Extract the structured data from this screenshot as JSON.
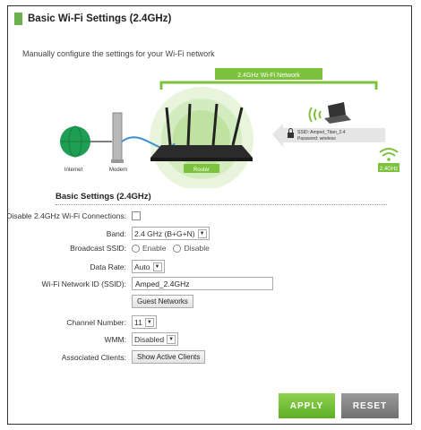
{
  "header": {
    "title": "Basic Wi-Fi Settings (2.4GHz)",
    "subtitle": "Manually configure the settings for your Wi-Fi network"
  },
  "diagram": {
    "network_label": "2.4GHz Wi-Fi Network",
    "internet_label": "Internet",
    "modem_label": "Modem",
    "router_label": "Router",
    "ssid_text": "SSID: Amped_Titan_2.4",
    "password_text": "Password: wireless",
    "band_badge": "2.4GHz"
  },
  "section": {
    "title": "Basic Settings (2.4GHz)"
  },
  "form": {
    "disable_label": "Disable 2.4GHz Wi-Fi Connections:",
    "band_label": "Band:",
    "band_value": "2.4 GHz (B+G+N)",
    "broadcast_label": "Broadcast SSID:",
    "enable_label": "Enable",
    "disable_opt_label": "Disable",
    "data_rate_label": "Data Rate:",
    "data_rate_value": "Auto",
    "ssid_label": "Wi-Fi Network ID (SSID):",
    "ssid_value": "Amped_2.4GHz",
    "guest_button": "Guest Networks",
    "channel_label": "Channel Number:",
    "channel_value": "11",
    "wmm_label": "WMM:",
    "wmm_value": "Disabled",
    "clients_label": "Associated Clients:",
    "clients_button": "Show Active Clients"
  },
  "actions": {
    "apply": "APPLY",
    "reset": "RESET"
  },
  "colors": {
    "accent_green": "#6ab04c",
    "apply_green": "#7cc23d",
    "reset_gray": "#888888"
  }
}
